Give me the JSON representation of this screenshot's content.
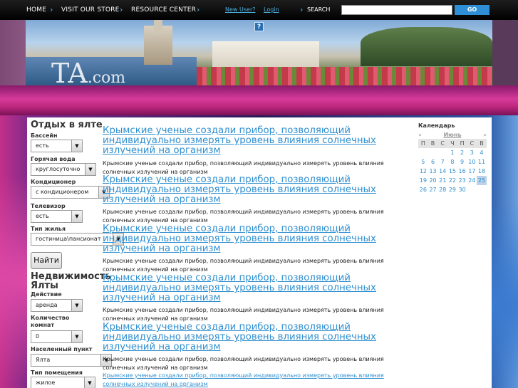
{
  "nav": {
    "home": "HOME",
    "store": "VISIT OUR STORE",
    "resource": "RESOURCE CENTER",
    "new_user": "New User?",
    "login": "Login",
    "search_label": "SEARCH",
    "search_value": "",
    "go": "GO"
  },
  "header": {
    "logo_main": "TA",
    "logo_suffix": ".com",
    "help": "?"
  },
  "sidebar": {
    "rest_title": "Отдых в ялте",
    "rest_fields": [
      {
        "label": "Бассейн",
        "value": "есть"
      },
      {
        "label": "Горячая вода",
        "value": "круглосуточно"
      },
      {
        "label": "Кондиционер",
        "value": "с кондиционером"
      },
      {
        "label": "Телевизор",
        "value": "есть"
      },
      {
        "label": "Тип жилья",
        "value": "гостиница\\пансионат"
      }
    ],
    "search_button": "Найти",
    "realty_title_1": "Недвижимость",
    "realty_title_2": "Ялты",
    "realty_fields": [
      {
        "label": "Действие",
        "value": "аренда"
      },
      {
        "label": "Количество комнат",
        "value": "0"
      },
      {
        "label": "Населенный пункт",
        "value": "Ялта"
      },
      {
        "label": "Тип помещения",
        "value": "жилое"
      }
    ]
  },
  "articles": {
    "title": "Крымские ученые создали прибор, позволяющий индивидуально измерять уровень влияния солнечных излучений на организм",
    "body": "Крымские ученые создали прибор, позволяющий индивидуально измерять уровень влияния солнечных излучений на организм",
    "link": "Крымские ученые создали прибор, позволяющий индивидуально измерять уровень влияния солнечных излучений на организм"
  },
  "calendar": {
    "title": "Календарь",
    "prev": "«",
    "month": "Июнь",
    "next": "»",
    "dows": [
      "П",
      "В",
      "С",
      "Ч",
      "П",
      "С",
      "В"
    ],
    "days": [
      "",
      "",
      "",
      "1",
      "2",
      "3",
      "4",
      "5",
      "6",
      "7",
      "8",
      "9",
      "10",
      "11",
      "12",
      "13",
      "14",
      "15",
      "16",
      "17",
      "18",
      "19",
      "20",
      "21",
      "22",
      "23",
      "24",
      "25",
      "26",
      "27",
      "28",
      "29",
      "30"
    ],
    "today": "25"
  }
}
